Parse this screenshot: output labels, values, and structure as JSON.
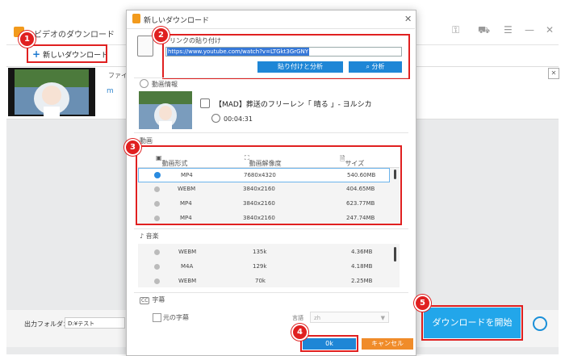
{
  "app": {
    "window_title": "ビデオのダウンロード",
    "new_download": "新しいダウンロード",
    "file_label": "ファイル",
    "file_item": "m",
    "output_folder_label": "出力フォルダ：",
    "output_folder_value": "D:¥テスト",
    "start_button": "ダウンロードを開始"
  },
  "dialog": {
    "title": "新しいダウンロード",
    "paste_section": "リンクの貼り付け",
    "url": "https://www.youtube.com/watch?v=LTGkt3GrGNY",
    "paste_analyze_button": "貼り付けと分析",
    "analyze_button": "分析",
    "video_info_section": "動画情報",
    "video_title": "【MAD】葬送のフリーレン「 晴る 」- ヨルシカ",
    "video_duration": "00:04:31",
    "video_section": "動画",
    "video_columns": [
      "動画形式",
      "動画解像度",
      "サイズ"
    ],
    "video_rows": [
      {
        "format": "MP4",
        "resolution": "7680x4320",
        "size": "540.60MB",
        "selected": true
      },
      {
        "format": "WEBM",
        "resolution": "3840x2160",
        "size": "404.65MB",
        "selected": false
      },
      {
        "format": "MP4",
        "resolution": "3840x2160",
        "size": "623.77MB",
        "selected": false
      },
      {
        "format": "MP4",
        "resolution": "3840x2160",
        "size": "247.74MB",
        "selected": false
      }
    ],
    "audio_section": "音楽",
    "audio_rows": [
      {
        "format": "WEBM",
        "bitrate": "135k",
        "size": "4.36MB"
      },
      {
        "format": "M4A",
        "bitrate": "129k",
        "size": "4.18MB"
      },
      {
        "format": "WEBM",
        "bitrate": "70k",
        "size": "2.25MB"
      }
    ],
    "subtitle_section": "字幕",
    "subtitle_checkbox": "元の字幕",
    "language_label": "言語",
    "language_value": "zh",
    "ok_button": "0k",
    "cancel_button": "キャンセル"
  },
  "markers": [
    "1",
    "2",
    "3",
    "4",
    "5"
  ],
  "colors": {
    "accent": "#1e86d6",
    "marker": "#e02020",
    "cancel": "#f08c2a",
    "start": "#22a6ea"
  }
}
